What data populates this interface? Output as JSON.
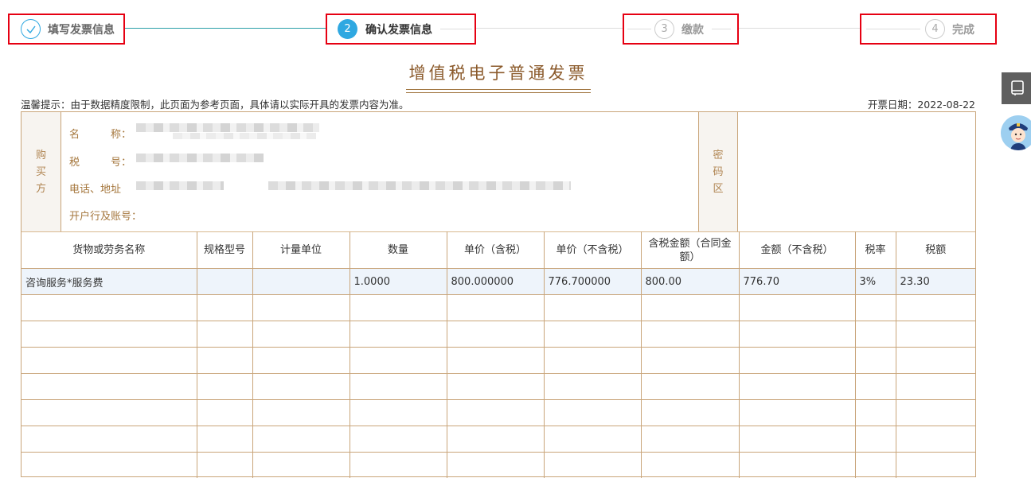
{
  "stepper": {
    "steps": [
      {
        "num": "✓",
        "label": "填写发票信息",
        "state": "done"
      },
      {
        "num": "2",
        "label": "确认发票信息",
        "state": "active"
      },
      {
        "num": "3",
        "label": "缴款",
        "state": "pending"
      },
      {
        "num": "4",
        "label": "完成",
        "state": "pending"
      }
    ]
  },
  "invoice": {
    "title": "增值税电子普通发票",
    "hint": "温馨提示：由于数据精度限制，此页面为参考页面，具体请以实际开具的发票内容为准。",
    "date_label": "开票日期：2022-08-22",
    "buyer": {
      "side_label": [
        "购",
        "买",
        "方"
      ],
      "name_label": "名　　　称：",
      "tax_label": "税　　　号：",
      "phone_label": "电话、地址",
      "bank_label": "开户行及账号："
    },
    "password_side": [
      "密",
      "码",
      "区"
    ],
    "columns": [
      "货物或劳务名称",
      "规格型号",
      "计量单位",
      "数量",
      "单价（含税）",
      "单价（不含税）",
      "含税金额（合同金额）",
      "金额（不含税）",
      "税率",
      "税额"
    ],
    "rows": [
      [
        "咨询服务*服务费",
        "",
        "",
        "1.0000",
        "800.000000",
        "776.700000",
        "800.00",
        "776.70",
        "3%",
        "23.30"
      ]
    ],
    "empty_rows": 7
  },
  "colors": {
    "accent_blue": "#2fa8e1",
    "border_tan": "#c9a57a",
    "title_brown": "#8b5a2b",
    "highlight_red": "#e60012"
  }
}
